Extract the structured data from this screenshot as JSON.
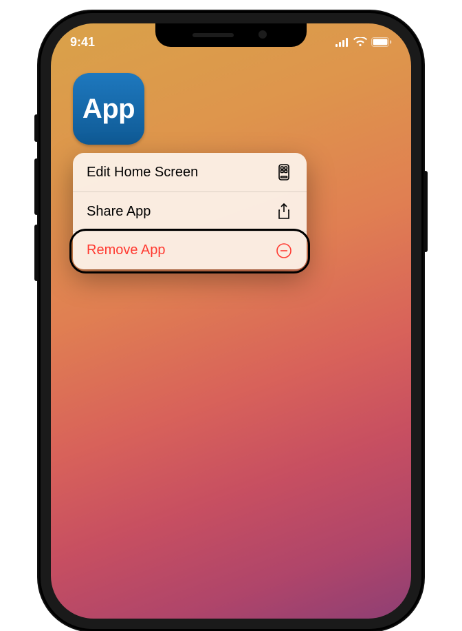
{
  "status": {
    "time": "9:41"
  },
  "app_icon": {
    "label": "App"
  },
  "menu": {
    "items": [
      {
        "label": "Edit Home Screen",
        "icon": "phone-home-icon",
        "destructive": false
      },
      {
        "label": "Share App",
        "icon": "share-icon",
        "destructive": false
      },
      {
        "label": "Remove App",
        "icon": "remove-icon",
        "destructive": true,
        "highlighted": true
      }
    ]
  }
}
